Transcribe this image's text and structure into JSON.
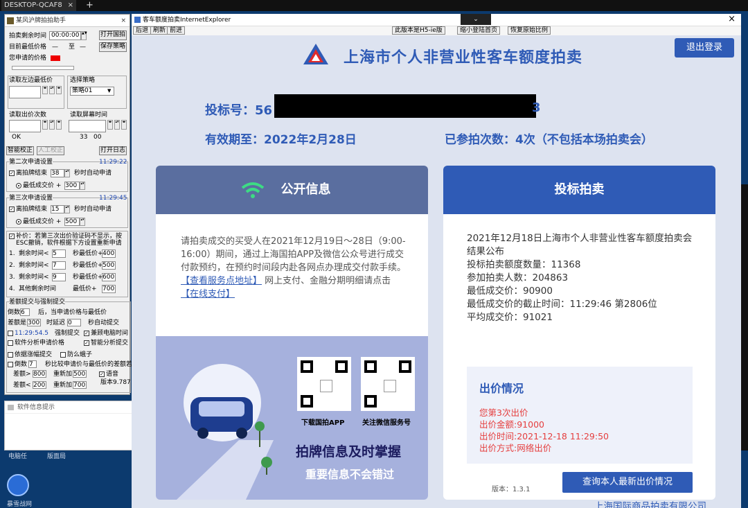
{
  "taskbar": {
    "tab": "DESKTOP-QCAF8",
    "close": "×",
    "plus": "+"
  },
  "helper": {
    "title": "某风沪牌拍拍助手",
    "close": "×",
    "remain_label": "拍卖剩余时间",
    "remain_value": "00:00:00",
    "open_btn": "打开国拍",
    "low_label": "目前最低价格",
    "low_value": "—",
    "to": "至",
    "to_value": "—",
    "save_btn": "保存策略",
    "yourprice_label": "您申请的价格",
    "read_low_label": "读取左边最低价",
    "strategy_label": "选择策略",
    "strategy_value": "策略01",
    "read_bids_label": "读取出价次数",
    "read_screen_label": "读取屏幕时间",
    "ok": "OK",
    "t1": "33",
    "t2": "00",
    "smart_btn": "智能校正",
    "manual_btn": "人工校正",
    "log_btn": "打开日志",
    "s2_title": "第二次申请设置",
    "s2_time": "11:29:22",
    "s2_row1a": "离拍牌结束",
    "s2_row1_val": "38",
    "s2_row1b": "秒时自动申请",
    "s2_row2a": "最低成交价 +",
    "s2_row2_val": "300",
    "s3_title": "第三次申请设置",
    "s3_time": "11:29:45",
    "s3_row1a": "离拍牌结束",
    "s3_row1_val": "15",
    "s3_row1b": "秒时自动申请",
    "s3_row2a": "最低成交价 +",
    "s3_row2_val": "500",
    "supp1": "补价：若第三次出价验证码不显示，按",
    "supp2": "ESC撤销，软件根据下方设置重新申请",
    "rows": [
      {
        "n": "1.",
        "a": "剩余时间<",
        "v": "5",
        "b": "秒最低价+",
        "p": "400"
      },
      {
        "n": "2.",
        "a": "剩余时间<",
        "v": "7",
        "b": "秒最低价+",
        "p": "500"
      },
      {
        "n": "3.",
        "a": "剩余时间<",
        "v": "9",
        "b": "秒最低价+",
        "p": "600"
      },
      {
        "n": "4.",
        "a": "其他剩余时间",
        "v": "",
        "b": "最低价+",
        "p": "700"
      }
    ],
    "diff_title": "差额提交与强制提交",
    "d1a": "倒数",
    "d1v": "6",
    "d1b": "后，当申请价格与最低价",
    "d2a": "差额是",
    "d2v": "300",
    "d2b": "时延迟",
    "d2v2": "0",
    "d2c": "秒自动提交",
    "d3a": "11:29:54.5",
    "d3b": "强制提交",
    "d3c": "兼顾电脑时间",
    "d4a": "软件分析申请价格",
    "d4b": "智能分析提交",
    "d5a": "依据涨幅提交",
    "d5b": "防么蛾子",
    "d6a": "倒数",
    "d6v": "7",
    "d6b": "秒比较申请价与最低价的差额若",
    "d7a": "差额>",
    "d7v": "800",
    "d7b": "重新加",
    "d7v2": "500",
    "d7c": "语音",
    "d8a": "差额<",
    "d8v": "200",
    "d8b": "重新加",
    "d8v2": "700",
    "d8c": "版本9.787"
  },
  "notice": {
    "title": "软件信息提示",
    "close": "×"
  },
  "desktop": {
    "icon1": "电脑任",
    "icon2": "版面局",
    "icon3": "暴雪战网"
  },
  "ie": {
    "title": "客车额度拍卖InternetExplorer",
    "close": "×",
    "dropdown": "⌄",
    "nav": [
      "后退",
      "刷新",
      "前进"
    ],
    "nav_right": [
      "此版本是H5-ie版",
      "缩小登陆首页",
      "恢复原始比例"
    ]
  },
  "page": {
    "site_title": "上海市个人非营业性客车额度拍卖",
    "logout": "退出登录",
    "bid_no_label": "投标号：56",
    "bid_no_tail": "3",
    "valid_until": "有效期至：2022年2月28日",
    "attempts": "已参拍次数：4次（不包括本场拍卖会）",
    "public": {
      "title": "公开信息",
      "text": "请拍卖成交的买受人在2021年12月19日～28日（9:00-16:00）期间，通过上海国拍APP及微信公众号进行成交付款预约，在预约时间段内赴各网点办理成交付款手续。",
      "link1": "【查看服务点地址】",
      "after_link": "网上支付、金融分期明细请点击",
      "link2": "【在线支付】",
      "qr1_caption": "下载国拍APP",
      "qr2_caption": "关注微信服务号",
      "slogan1": "拍牌信息及时掌握",
      "slogan2": "重要信息不会错过"
    },
    "auction": {
      "title": "投标拍卖",
      "lines": [
        "2021年12月18日上海市个人非营业性客车额度拍卖会结果公布",
        "投标拍卖额度数量：11368",
        "参加拍卖人数：204863",
        "最低成交价：90900",
        "最低成交价的截止时间：11:29:46 第2806位",
        "平均成交价：91021"
      ],
      "bid_box_title": "出价情况",
      "bid_lines": [
        "您第3次出价",
        "出价金额:91000",
        "出价时间:2021-12-18 11:29:50",
        "出价方式:网络出价"
      ],
      "version": "版本：1.3.1",
      "query_btn": "查询本人最新出价情况"
    },
    "footer": "上海国际商品拍卖有限公司"
  }
}
